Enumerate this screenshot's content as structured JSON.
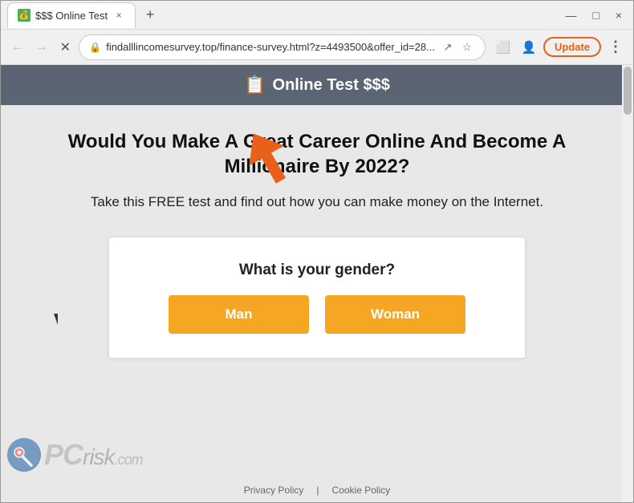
{
  "window": {
    "title": "$$$  Online Test",
    "favicon": "💰",
    "tab_close": "×",
    "new_tab": "+",
    "controls": {
      "minimize": "—",
      "maximize": "□",
      "close": "×"
    }
  },
  "address_bar": {
    "url": "findalllincomesurvey.top/finance-survey.html?z=4493500&offer_id=28...",
    "lock_icon": "🔒",
    "back_icon": "←",
    "forward_icon": "→",
    "reload_icon": "✕",
    "update_label": "Update"
  },
  "site_header": {
    "icon": "📋",
    "title": "Online Test $$$"
  },
  "main": {
    "heading": "Would You Make A Great Career Online And Become A Millionaire By 2022?",
    "subtext": "Take this FREE test and find out how you can make money on the Internet."
  },
  "survey": {
    "question": "What is your gender?",
    "options": [
      {
        "label": "Man",
        "id": "man"
      },
      {
        "label": "Woman",
        "id": "woman"
      }
    ]
  },
  "footer": {
    "links": [
      {
        "label": "Privacy Policy"
      },
      {
        "label": "Cookie Policy"
      }
    ],
    "separator": "|"
  },
  "watermark": {
    "text": "PC risk.com"
  }
}
